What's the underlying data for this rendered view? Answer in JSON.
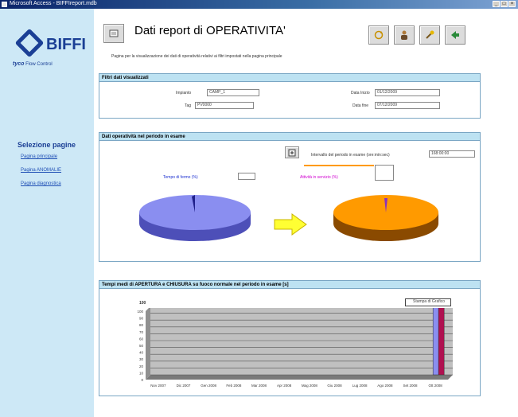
{
  "window": {
    "title": "Microsoft Access - BIFFIreport.mdb"
  },
  "logo": {
    "brand": "BIFFI",
    "tagline_brand": "tyco",
    "tagline": "Flow Control"
  },
  "sidebar": {
    "section_title": "Selezione pagine",
    "links": [
      "Pagina principale",
      "Pagina ANOMALIE",
      "Pagina diagnostica"
    ]
  },
  "header": {
    "title": "Dati report di OPERATIVITA'",
    "subtitle": "Pagina per la visualizzazione dei dati di operatività relativi ai filtri impostati nella pagina principale"
  },
  "filters": {
    "heading": "Filtri dati visualizzati",
    "impianto_label": "Impianto",
    "impianto_value": "CAMP_1",
    "tag_label": "Tag",
    "tag_value": "PV0000",
    "data_inizio_label": "Data Inizio",
    "data_inizio_value": "01/12/2009",
    "data_fine_label": "Data fine",
    "data_fine_value": "07/12/2009"
  },
  "operational": {
    "heading": "Dati operatività nel periodo in esame",
    "period_label": "Intervallo del periodo in esame (ore:min:sec)",
    "period_value": "168:00:00",
    "stop_label": "Tempo di fermo (%)",
    "stop_value": "",
    "run_label": "Attività in servizio (%)",
    "run_value": ""
  },
  "trend": {
    "heading": "Tempi medi di APERTURA e CHIUSURA su fuoco normale nel periodo in esame [s]",
    "button_label": "Stampa di Grafico",
    "y_top_label": "100"
  },
  "colors": {
    "sidebar_bg": "#cde8f6",
    "panel_head": "#bde2f2",
    "pie_left": "#8a8ef0",
    "pie_right": "#ff9a00",
    "arrow": "#ffff33"
  },
  "chart_data": {
    "type": "bar",
    "title": "Tempi medi di APERTURA e CHIUSURA su fuoco normale nel periodo in esame [s]",
    "categories": [
      "Nov 2007",
      "Dic 2007",
      "Gen 2008",
      "Feb 2008",
      "Mar 2008",
      "Apr 2008",
      "Mag 2008",
      "Giu 2008",
      "Lug 2008",
      "Ago 2008",
      "Set 2008",
      "Ott 2008"
    ],
    "series": [
      {
        "values": [
          0,
          0,
          0,
          0,
          0,
          0,
          0,
          0,
          0,
          0,
          0,
          100
        ]
      },
      {
        "values": [
          0,
          0,
          0,
          0,
          0,
          0,
          0,
          0,
          0,
          0,
          0,
          100
        ]
      }
    ],
    "ylim": [
      0,
      100
    ],
    "y_ticks": [
      0,
      10,
      20,
      30,
      40,
      50,
      60,
      70,
      80,
      90,
      100
    ],
    "grid": true
  }
}
